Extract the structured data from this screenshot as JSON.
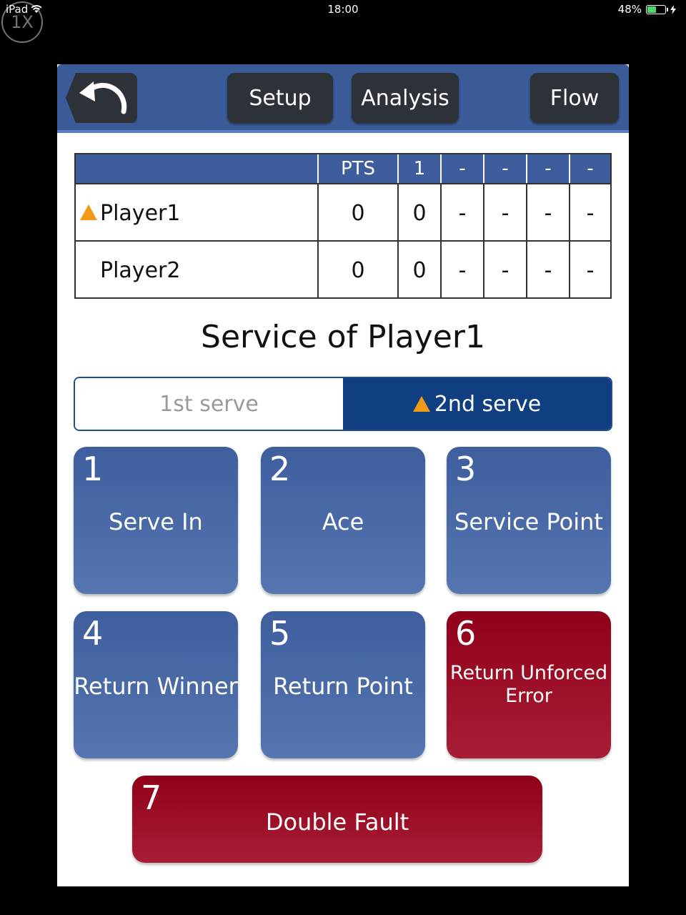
{
  "status_bar": {
    "device": "iPad",
    "time": "18:00",
    "battery": "48%",
    "zoom_badge": "1X",
    "battery_level": 0.48
  },
  "toolbar": {
    "back_icon": "undo-arrow-icon",
    "setup": "Setup",
    "analysis": "Analysis",
    "flow": "Flow"
  },
  "scoreboard": {
    "headers": [
      "",
      "PTS",
      "1",
      "-",
      "-",
      "-",
      "-"
    ],
    "rows": [
      {
        "name": "Player1",
        "serving": true,
        "pts": "0",
        "sets": [
          "0",
          "-",
          "-",
          "-",
          "-"
        ]
      },
      {
        "name": "Player2",
        "serving": false,
        "pts": "0",
        "sets": [
          "0",
          "-",
          "-",
          "-",
          "-"
        ]
      }
    ]
  },
  "service_title": "Service of Player1",
  "serve_toggle": {
    "first": "1st serve",
    "second": "2nd serve",
    "selected": "second"
  },
  "actions": [
    {
      "num": "1",
      "label": "Serve In",
      "color": "#3e5e9e"
    },
    {
      "num": "2",
      "label": "Ace",
      "color": "#3e5e9e"
    },
    {
      "num": "3",
      "label": "Service Point",
      "color": "#3e5e9e"
    },
    {
      "num": "4",
      "label": "Return Winner",
      "color": "#3e5e9e"
    },
    {
      "num": "5",
      "label": "Return Point",
      "color": "#3e5e9e"
    },
    {
      "num": "6",
      "label": "Return Unforced Error",
      "color": "#8f0118"
    },
    {
      "num": "7",
      "label": "Double Fault",
      "color": "#8f0118"
    }
  ],
  "colors": {
    "toolbar": "#3a5b98",
    "serve_indicator": "#f19a18",
    "selected_serve": "#0f3f80"
  }
}
